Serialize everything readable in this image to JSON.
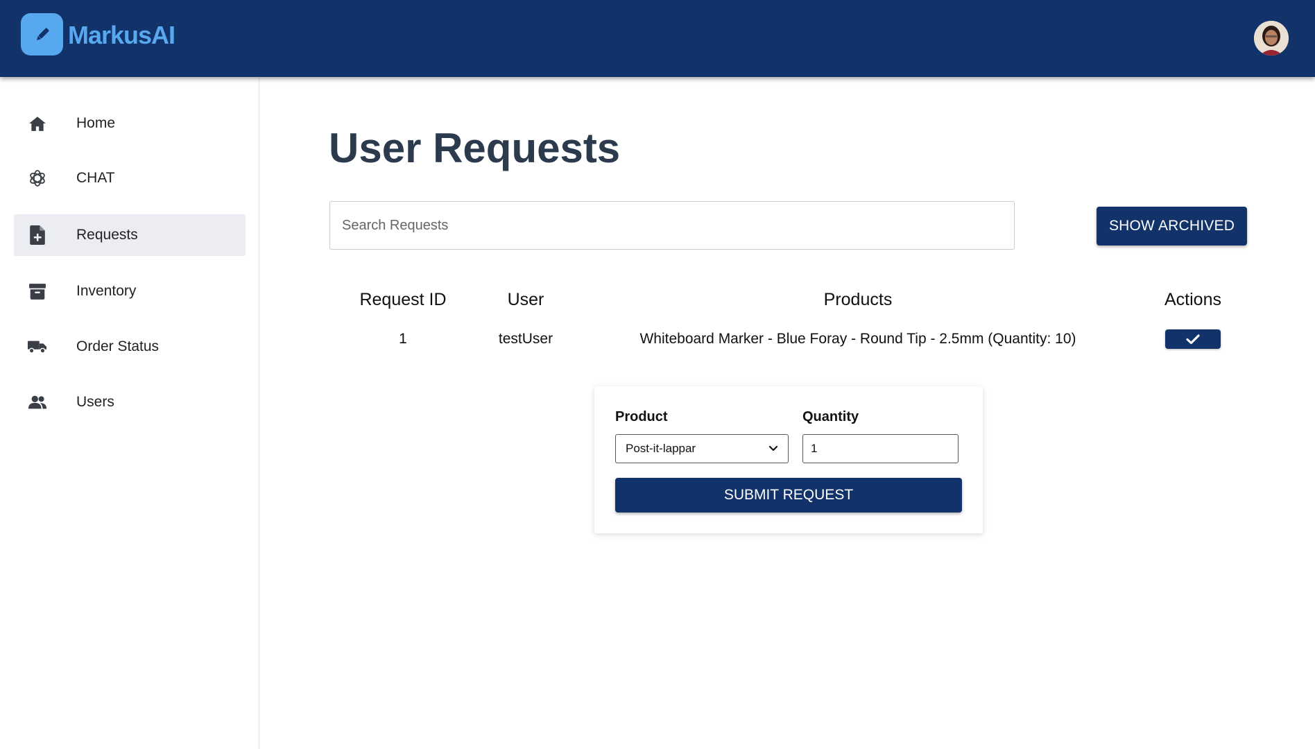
{
  "app": {
    "name": "MarkusAI",
    "logo_icon": "pencil-icon",
    "brand_color": "#12326a",
    "accent_color": "#58a8f0"
  },
  "sidebar": {
    "items": [
      {
        "label": "Home",
        "icon": "home-icon",
        "active": false
      },
      {
        "label": "CHAT",
        "icon": "chat-icon",
        "active": false
      },
      {
        "label": "Requests",
        "icon": "file-plus-icon",
        "active": true
      },
      {
        "label": "Inventory",
        "icon": "archive-box-icon",
        "active": false
      },
      {
        "label": "Order Status",
        "icon": "truck-icon",
        "active": false
      },
      {
        "label": "Users",
        "icon": "users-icon",
        "active": false
      }
    ]
  },
  "main": {
    "title": "User Requests",
    "search": {
      "placeholder": "Search Requests",
      "value": ""
    },
    "show_archived_label": "SHOW ARCHIVED",
    "table": {
      "headers": [
        "Request ID",
        "User",
        "Products",
        "Actions"
      ],
      "rows": [
        {
          "id": "1",
          "user": "testUser",
          "products": "Whiteboard Marker - Blue Foray - Round Tip - 2.5mm (Quantity: 10)",
          "action_icon": "check-icon"
        }
      ]
    },
    "form": {
      "product_label": "Product",
      "quantity_label": "Quantity",
      "product_selected": "Post-it-lappar",
      "quantity_value": "1",
      "submit_label": "SUBMIT REQUEST"
    }
  }
}
